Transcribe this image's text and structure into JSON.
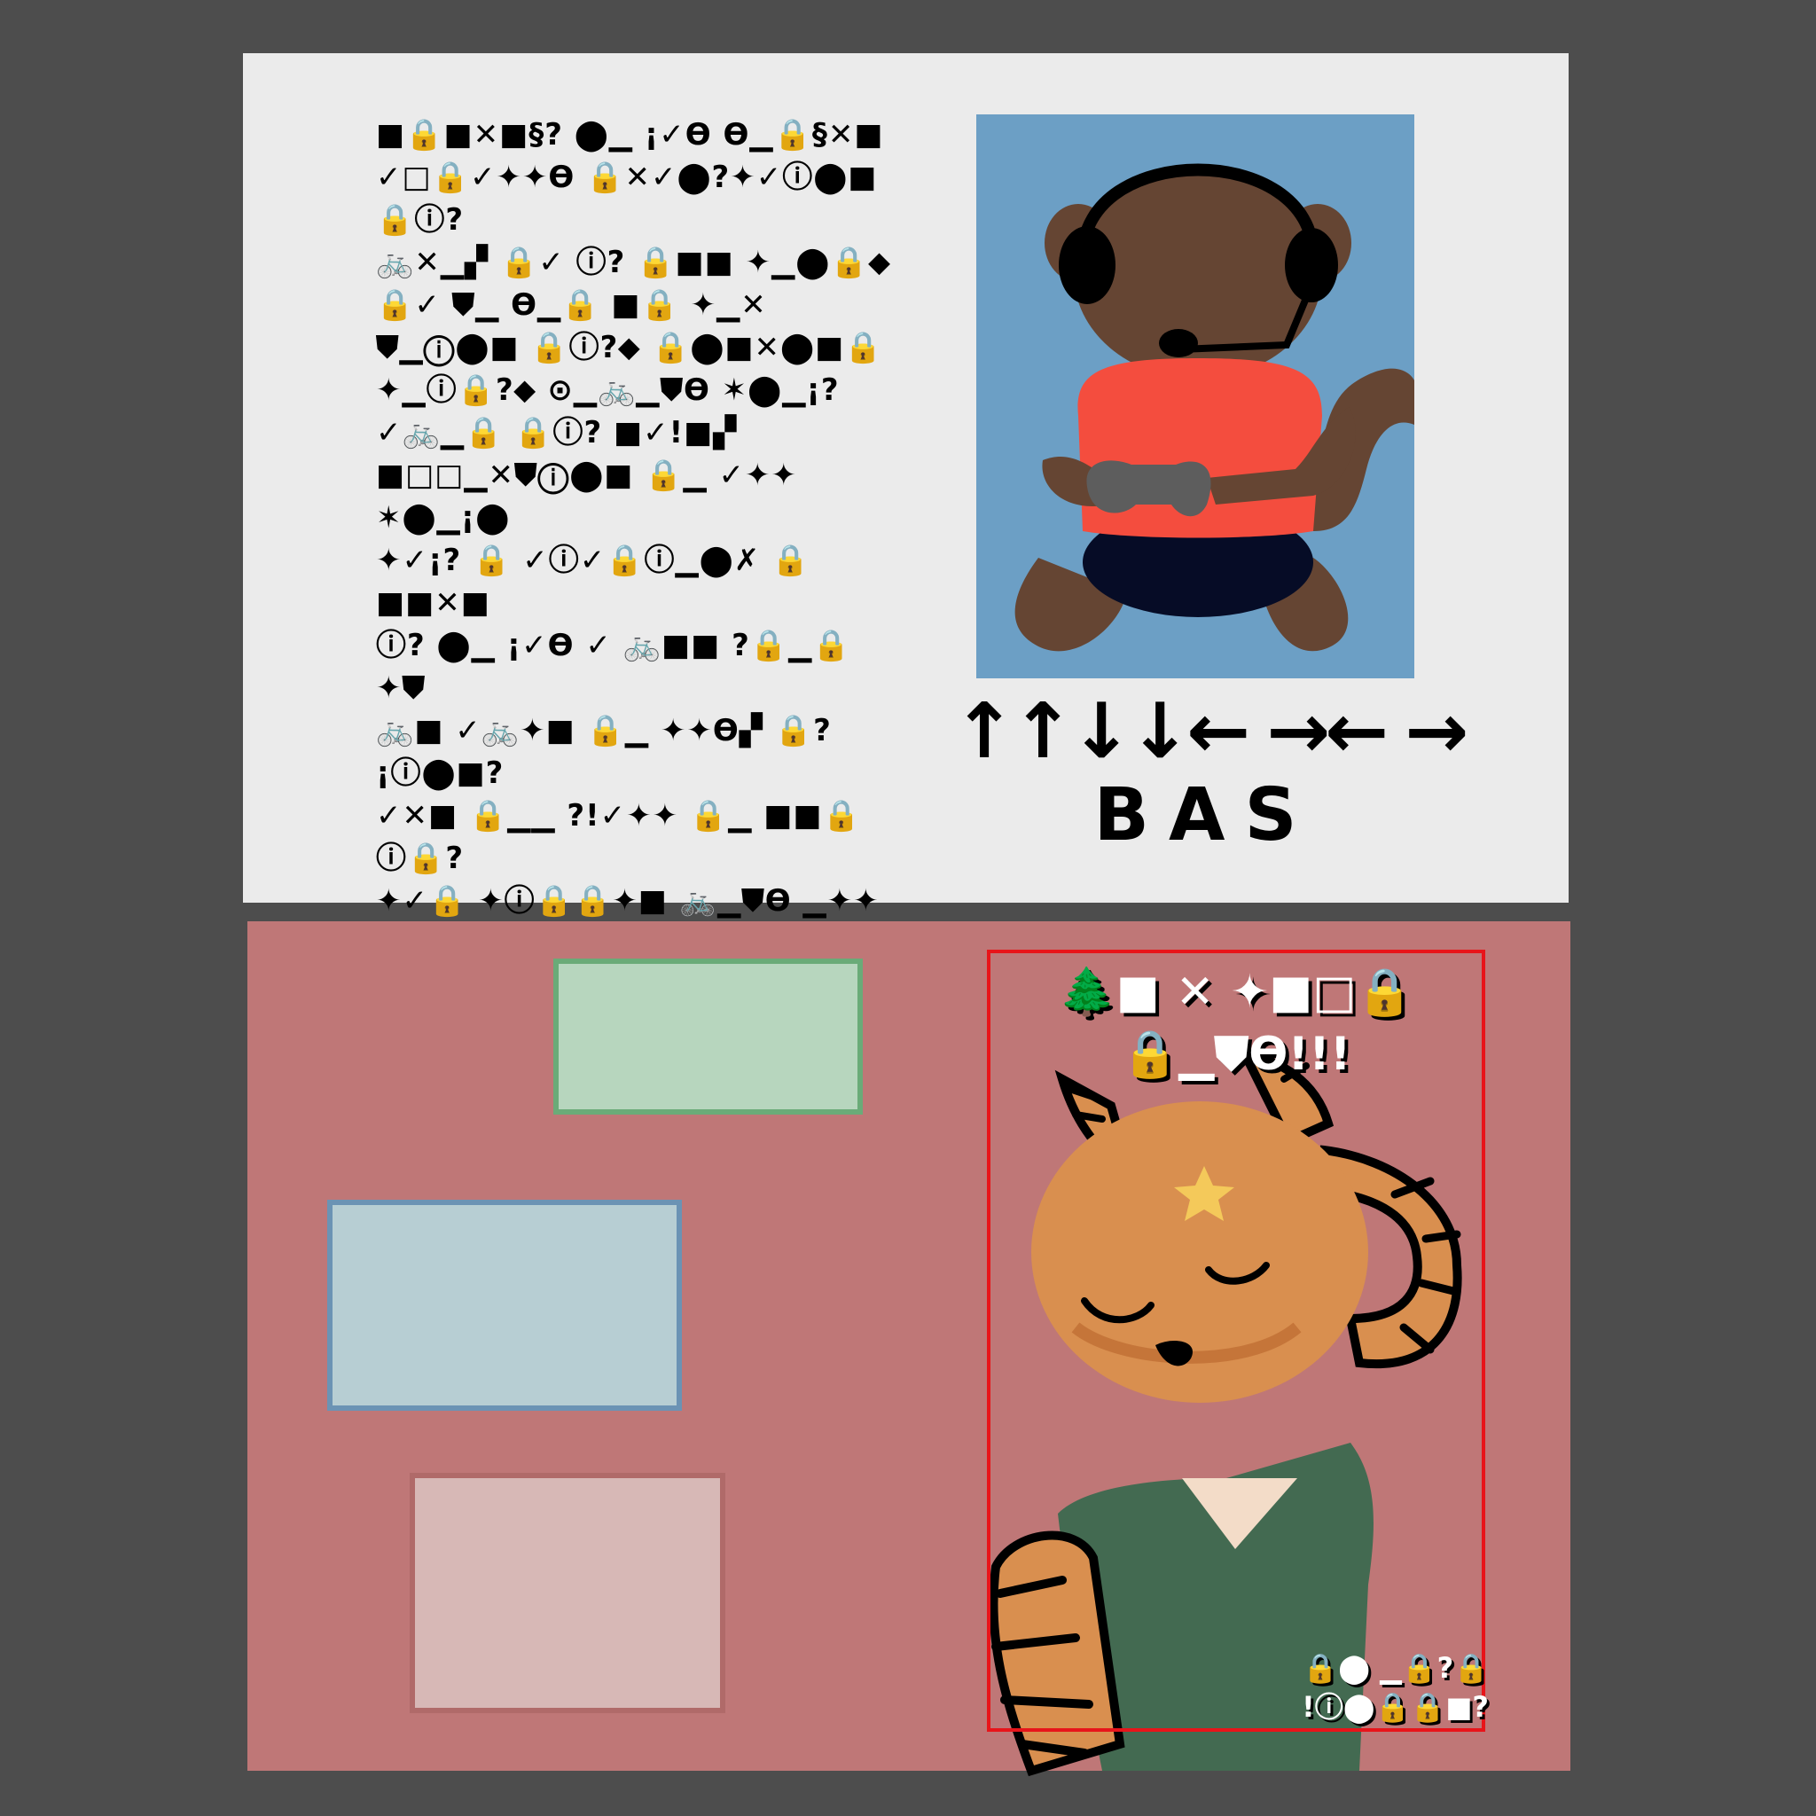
{
  "upper_card": {
    "paragraph_1": "■🔒■✕■§? ⬤▁ ¡✓ϴ ϴ▁🔒§✕■\n✓□🔒✓✦✦ϴ 🔒✕✓⬤?✦✓ⓘ⬤■ 🔒ⓘ?\n🚲✕▁▞ 🔒✓ ⓘ? 🔒■■ ✦▁⬤🔒⬥\n🔒✓ ⛊▁ ϴ▁🔒 ■🔒 ✦▁✕\n⛊▁ⓘ⬤■ 🔒ⓘ?⬥ 🔒⬤■✕⬤■🔒\n✦▁ⓘ🔒?⬥ ⊙▁🚲▁⛊ϴ ✶⬤▁¡?\n✓🚲▁🔒 🔒ⓘ? ■✓!■▞",
    "paragraph_2": "■□□▁✕⛊ⓘ⬤■ 🔒▁ ✓✦✦ ✶⬤▁¡⬤\n✦✓¡? 🔒 ✓ⓘ✓🔒ⓘ▁⬤✗ 🔒■■✕■\nⓘ? ⬤▁ ¡✓ϴ ✓ 🚲■■ ?🔒▁🔒✦⛊\n🚲■ ✓🚲✦■ 🔒▁ ✦✦ϴ▞ 🔒? ¡ⓘ⬤■?\n✓✕■ 🔒▁▁ ?!✓✦✦ 🔒▁ ■■🔒 ⓘ🔒?\n✦✓🔒 ✦ⓘ🔒🔒✦■ 🚲▁⛊ϴ ▁✦✦ 🔒■■\n■✕▁🔒⬤⛊▞ ■🔒■ 🚲■■✗ ▁✦\n□▁🔒✕?■✗ ✦✦ⓘ? ✓⬤ϴ¡✓ϴ▞",
    "combo_arrows": "↑↑↓↓← →← →",
    "combo_buttons": "BAS"
  },
  "lower_panel": {
    "portrait_title": "🌲■ ✕ ✦■□🔒\n🔒▁⛊ϴ!!!",
    "portrait_caption": "🔒⬤ ▁🔒?🔒\n!ⓘ⬤🔒🔒■?"
  },
  "colors": {
    "page_background": "#4d4d4d",
    "card_background": "#ebebeb",
    "monkey_frame_blue": "#6c9fc5",
    "lower_panel": "#bf7777",
    "slot_green": "#b7d6be",
    "slot_blue": "#b7ced3",
    "slot_pink": "#d7b8b6",
    "portrait_frame_red": "#e8141a"
  }
}
